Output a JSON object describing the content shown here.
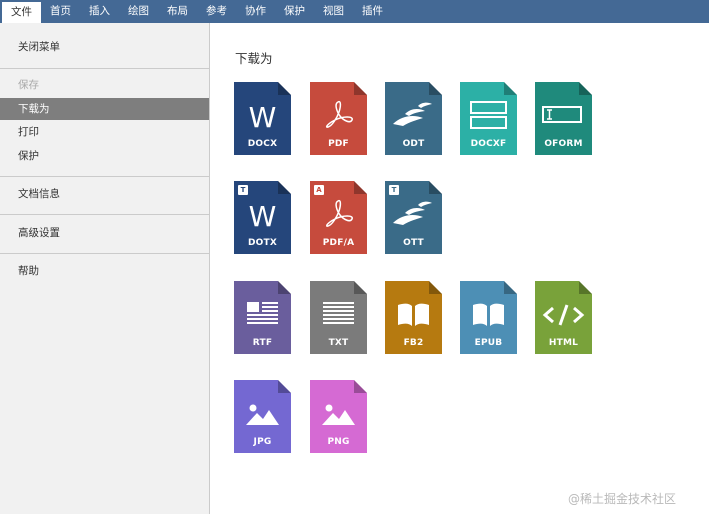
{
  "menubar": {
    "tabs": [
      {
        "label": "文件",
        "active": true
      },
      {
        "label": "首页"
      },
      {
        "label": "插入"
      },
      {
        "label": "绘图"
      },
      {
        "label": "布局"
      },
      {
        "label": "参考"
      },
      {
        "label": "协作"
      },
      {
        "label": "保护"
      },
      {
        "label": "视图"
      },
      {
        "label": "插件"
      }
    ]
  },
  "sidebar": {
    "close_menu": "关闭菜单",
    "save": "保存",
    "download_as": "下载为",
    "print": "打印",
    "protect": "保护",
    "doc_info": "文档信息",
    "advanced_settings": "高级设置",
    "help": "帮助"
  },
  "main": {
    "title": "下载为",
    "formats": [
      {
        "label": "DOCX",
        "color": "#25467b",
        "icon": "word-icon"
      },
      {
        "label": "PDF",
        "color": "#c64b3d",
        "icon": "pdf-icon"
      },
      {
        "label": "ODT",
        "color": "#3a6b88",
        "icon": "odt-icon"
      },
      {
        "label": "DOCXF",
        "color": "#2cb0a6",
        "icon": "form-template-icon"
      },
      {
        "label": "OFORM",
        "color": "#1f8a7c",
        "icon": "form-field-icon"
      },
      {
        "label": "DOTX",
        "color": "#25467b",
        "icon": "word-icon",
        "badge": "T"
      },
      {
        "label": "PDF/A",
        "color": "#c64b3d",
        "icon": "pdf-icon",
        "badge": "A"
      },
      {
        "label": "OTT",
        "color": "#3a6b88",
        "icon": "odt-icon",
        "badge": "T"
      },
      {
        "label": "RTF",
        "color": "#6a5e9d",
        "icon": "rich-text-icon"
      },
      {
        "label": "TXT",
        "color": "#7b7b7b",
        "icon": "text-lines-icon"
      },
      {
        "label": "FB2",
        "color": "#b67a10",
        "icon": "open-book-icon"
      },
      {
        "label": "EPUB",
        "color": "#4d8fb5",
        "icon": "open-book-icon"
      },
      {
        "label": "HTML",
        "color": "#79a23a",
        "icon": "code-icon"
      },
      {
        "label": "JPG",
        "color": "#7468d2",
        "icon": "image-icon"
      },
      {
        "label": "PNG",
        "color": "#d56ad3",
        "icon": "image-icon"
      }
    ]
  },
  "watermark": "@稀土掘金技术社区"
}
